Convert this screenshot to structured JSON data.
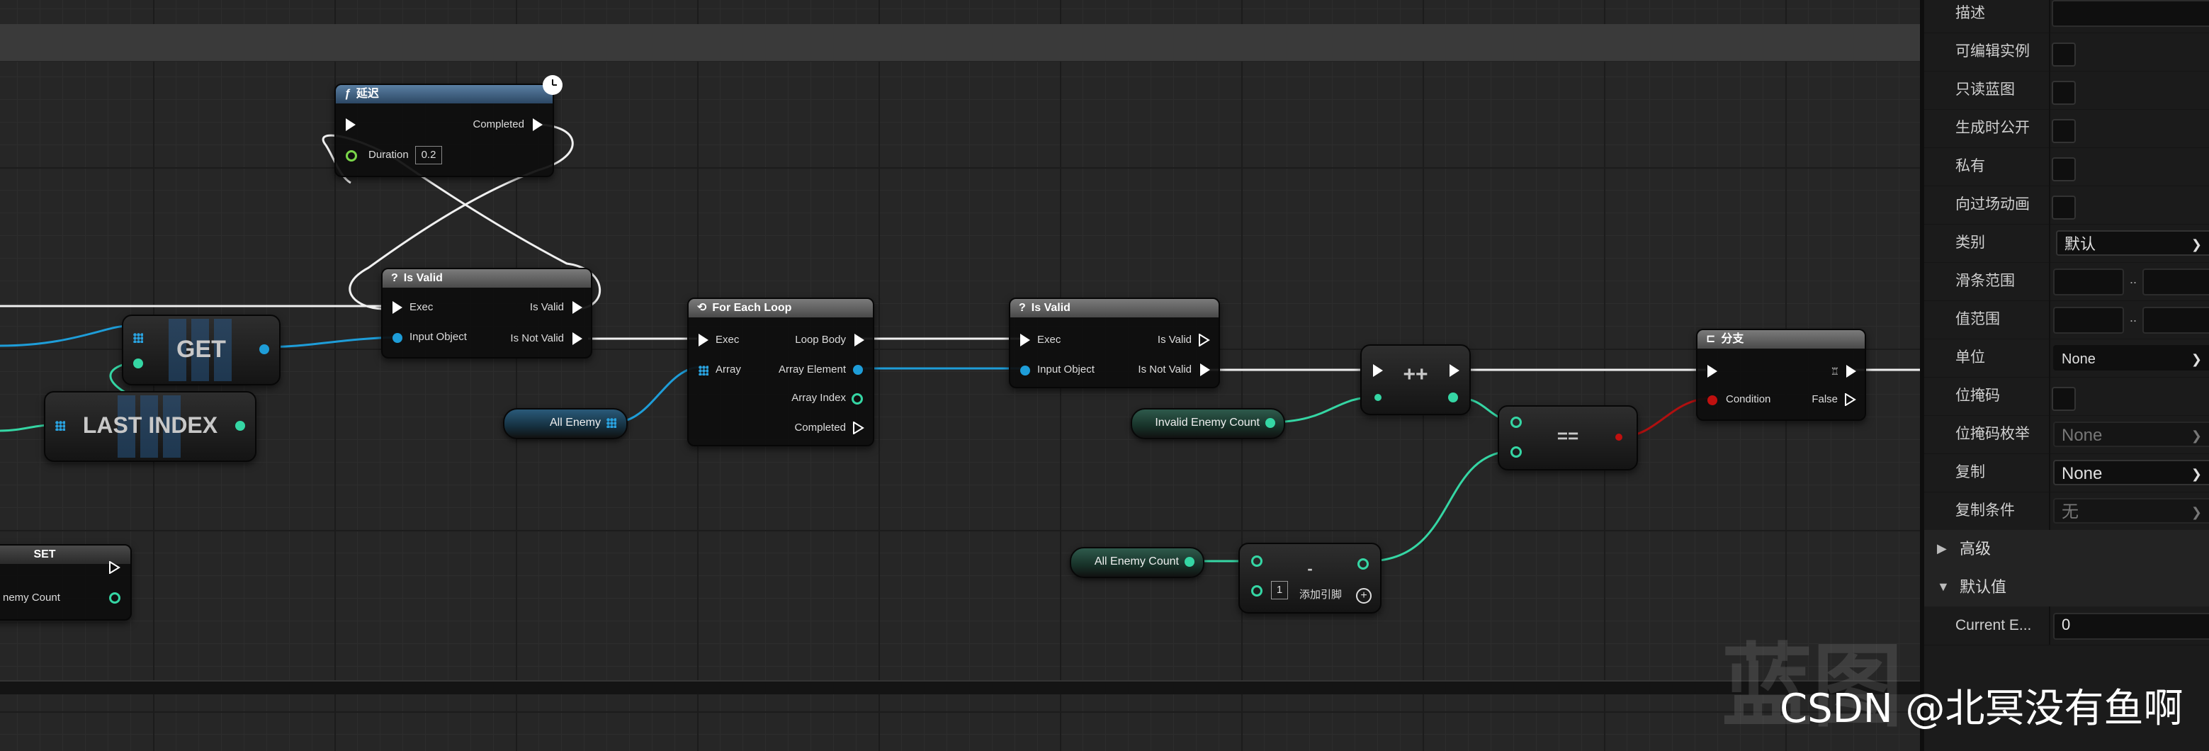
{
  "graph": {
    "delay_node": {
      "title": "延迟",
      "completed": "Completed",
      "duration_label": "Duration",
      "duration_value": "0.2"
    },
    "get_node": {
      "label": "GET"
    },
    "last_index_node": {
      "label": "LAST INDEX"
    },
    "is_valid_1": {
      "title": "Is Valid",
      "exec": "Exec",
      "is_valid": "Is Valid",
      "input_object": "Input Object",
      "is_not_valid": "Is Not Valid"
    },
    "for_each": {
      "title": "For Each Loop",
      "exec": "Exec",
      "loop_body": "Loop Body",
      "array": "Array",
      "array_element": "Array Element",
      "array_index": "Array Index",
      "completed": "Completed"
    },
    "all_enemy_var": {
      "label": "All Enemy"
    },
    "is_valid_2": {
      "title": "Is Valid",
      "exec": "Exec",
      "is_valid": "Is Valid",
      "input_object": "Input Object",
      "is_not_valid": "Is Not Valid"
    },
    "increment": {
      "label": "++"
    },
    "invalid_enemy_var": {
      "label": "Invalid Enemy Count"
    },
    "equals": {
      "label": "=="
    },
    "branch": {
      "title": "分支",
      "condition": "Condition",
      "false_label": "False"
    },
    "all_enemy_count_var": {
      "label": "All Enemy Count"
    },
    "subtract": {
      "label": "-",
      "value": "1",
      "add_pin": "添加引脚"
    },
    "set_node": {
      "title": "SET",
      "pin_label": "nemy Count"
    }
  },
  "panel": {
    "rows": [
      {
        "label": "描述"
      },
      {
        "label": "可编辑实例"
      },
      {
        "label": "只读蓝图"
      },
      {
        "label": "生成时公开"
      },
      {
        "label": "私有"
      },
      {
        "label": "向过场动画"
      },
      {
        "label": "类别",
        "value": "默认"
      },
      {
        "label": "滑条范围",
        "sep": ".."
      },
      {
        "label": "值范围",
        "sep": ".."
      },
      {
        "label": "单位",
        "value": "None"
      },
      {
        "label": "位掩码"
      },
      {
        "label": "位掩码枚举",
        "value": "None"
      },
      {
        "label": "复制",
        "value": "None"
      },
      {
        "label": "复制条件",
        "value": "无"
      }
    ],
    "sections": {
      "advanced": "高级",
      "default_value": "默认值"
    },
    "current_row": {
      "label": "Current E...",
      "value": "0"
    }
  },
  "watermark": {
    "big": "蓝图",
    "text": "CSDN @北冥没有鱼啊"
  }
}
